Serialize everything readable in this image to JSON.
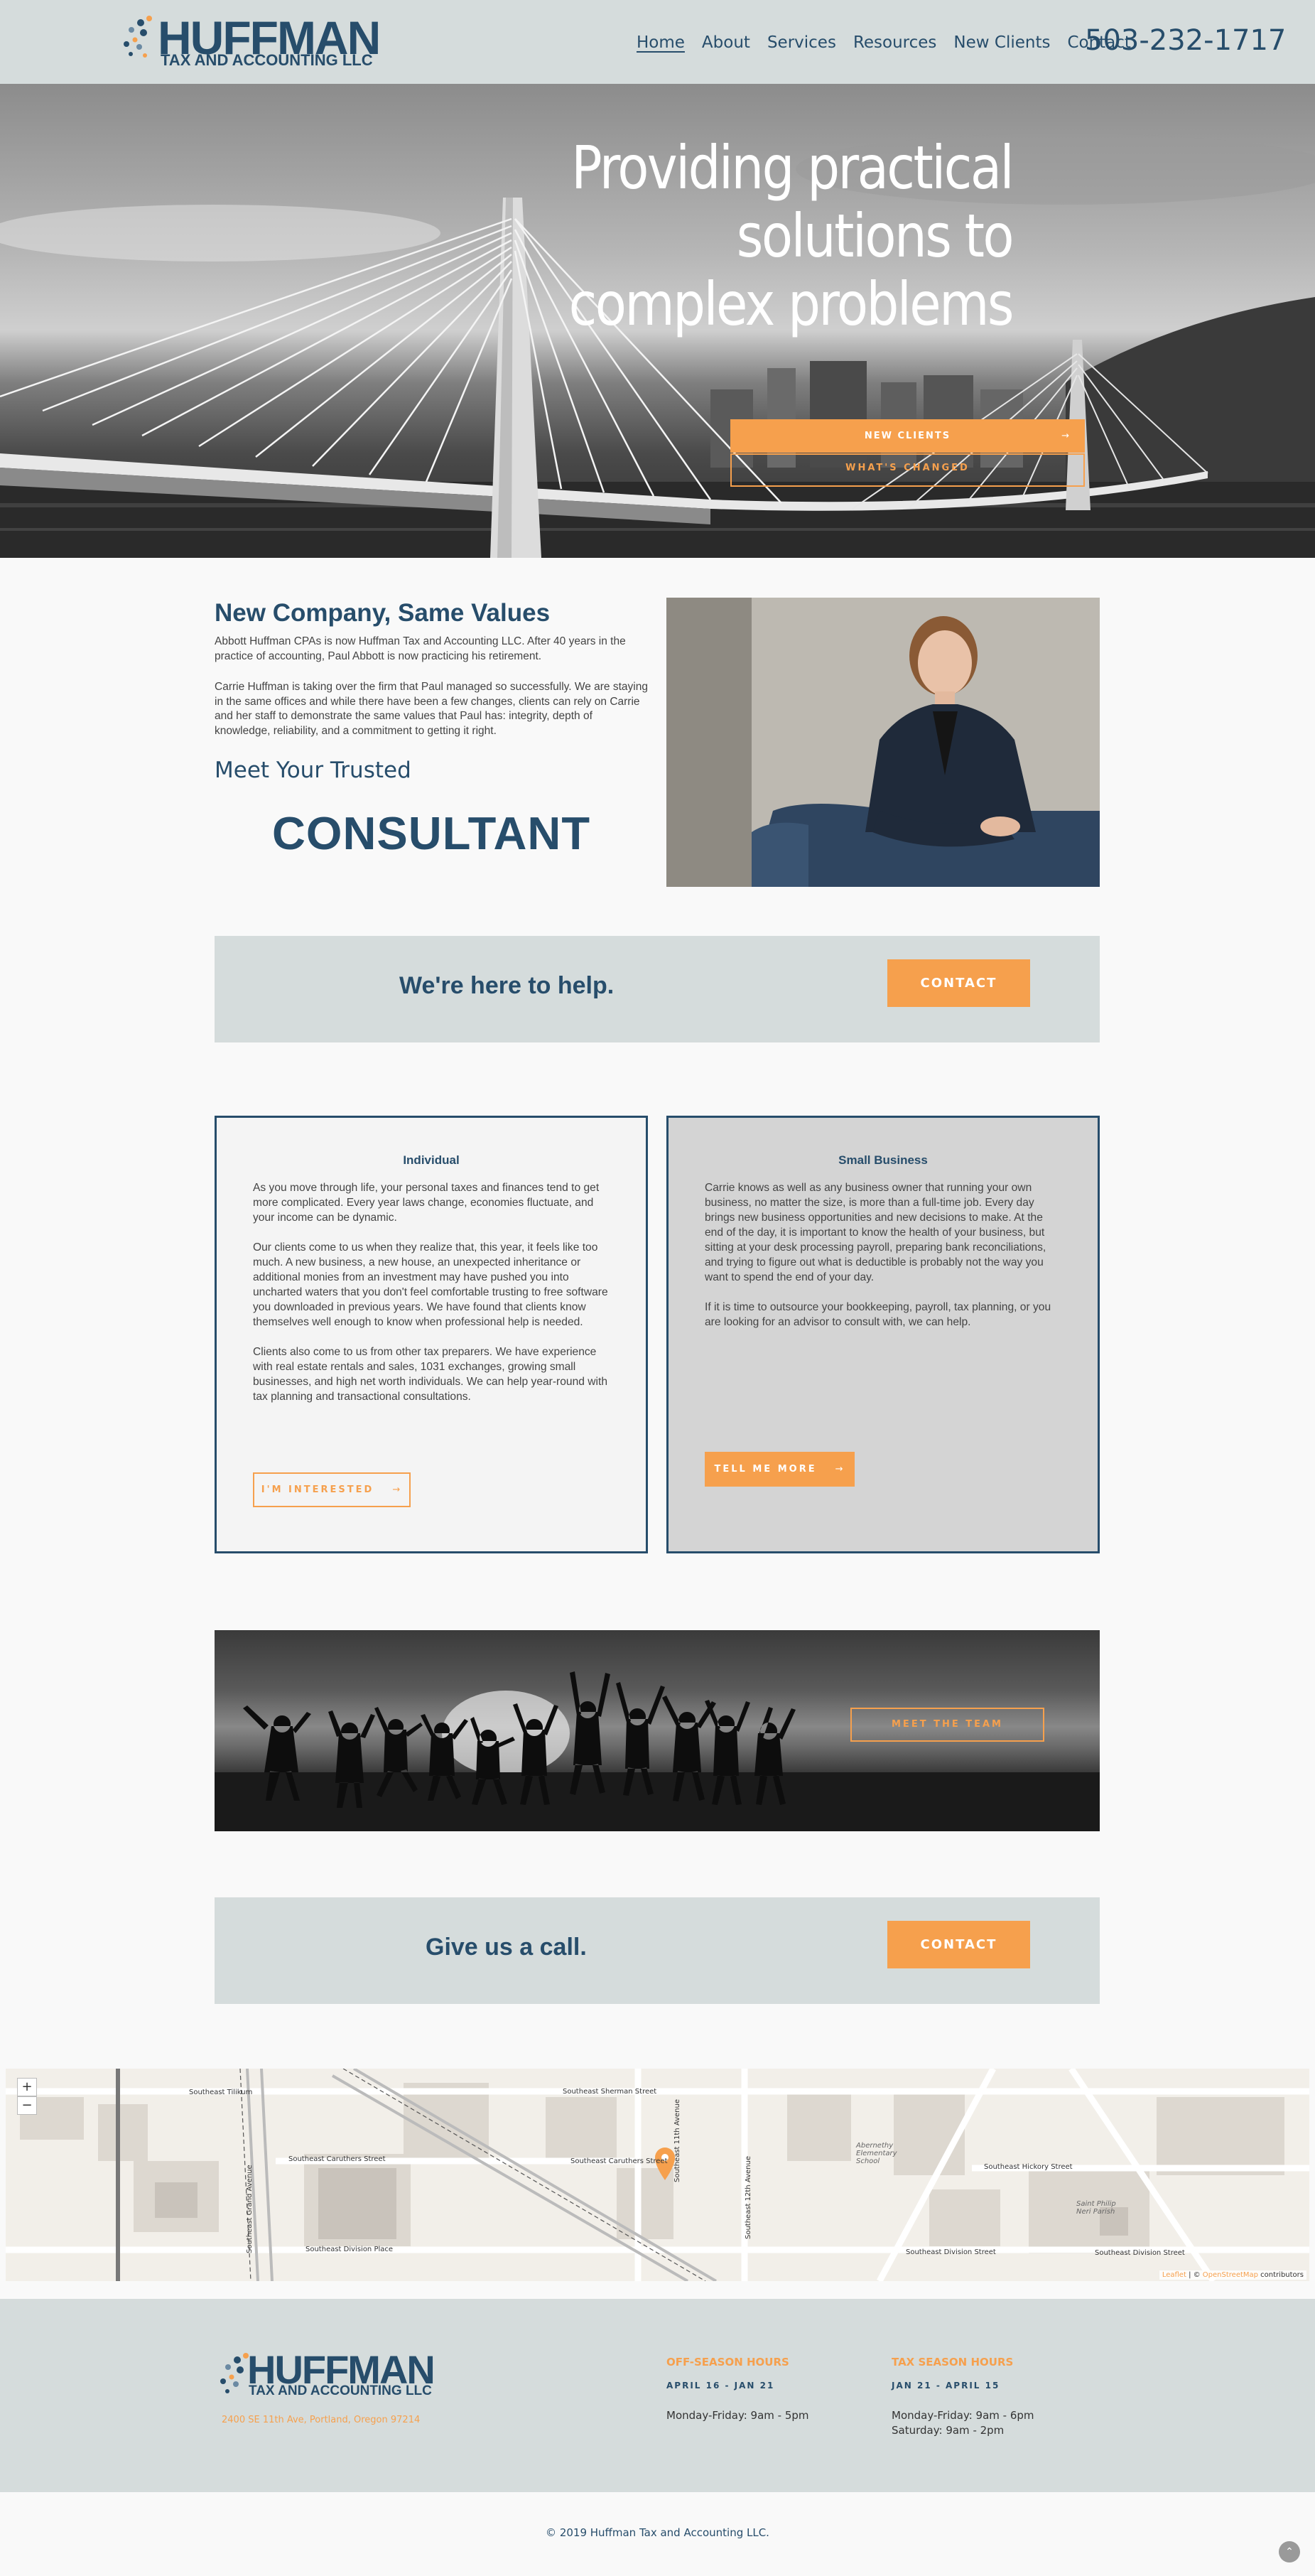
{
  "brand": {
    "name": "HUFFMAN",
    "subtitle": "TAX AND ACCOUNTING LLC"
  },
  "nav": {
    "items": [
      {
        "label": "Home",
        "active": true
      },
      {
        "label": "About"
      },
      {
        "label": "Services"
      },
      {
        "label": "Resources"
      },
      {
        "label": "New Clients"
      },
      {
        "label": "Contact"
      }
    ],
    "phone": "503-232-1717"
  },
  "hero": {
    "title_line1": "Providing practical solutions to",
    "title_line2": "complex problems",
    "primary_button": "NEW CLIENTS",
    "secondary_button": "WHAT'S CHANGED"
  },
  "intro": {
    "title": "New Company, Same Values",
    "paragraph1": "Abbott Huffman CPAs is now Huffman Tax and Accounting LLC. After 40 years in the practice of accounting, Paul Abbott is now practicing his retirement.",
    "paragraph2": "Carrie Huffman is taking over the firm that Paul managed so successfully. We are staying in the same offices and while there have been a few changes, clients can rely on Carrie and her staff to demonstrate the same values that Paul has: integrity, depth of knowledge, reliability, and a commitment to getting it right.",
    "meet_heading": "Meet Your Trusted",
    "rotating_word": "CONSULTANT"
  },
  "cta1": {
    "text": "We're here to help.",
    "button": "CONTACT"
  },
  "cards": {
    "individual": {
      "title": "Individual",
      "p1": "As you move through life, your personal taxes and finances tend to get more complicated. Every year laws change, economies fluctuate, and your income can be dynamic.",
      "p2": "Our clients come to us when they realize that, this year, it feels like too much. A new business, a new house, an unexpected inheritance or additional monies from an investment may have pushed you into uncharted waters that you don't feel comfortable trusting to free software you downloaded in previous years. We have found that clients know themselves well enough to know when professional help is needed.",
      "p3": "Clients also come to us from other tax preparers. We have experience with real estate rentals and sales, 1031 exchanges, growing small businesses, and high net worth individuals. We can help year-round with tax planning and transactional consultations.",
      "button": "I'M INTERESTED"
    },
    "small_business": {
      "title": "Small Business",
      "p1": "Carrie knows as well as any business owner that running your own business, no matter the size, is more than a full-time job. Every day brings new business opportunities and new decisions to make. At the end of the day, it is important to know the health of your business, but sitting at your desk processing payroll, preparing bank reconciliations, and trying to figure out what is deductible is probably not the way you want to spend the end of your day.",
      "p2": "If it is time to outsource your bookkeeping, payroll, tax planning, or you are looking for an advisor to consult with, we can help.",
      "button": "TELL ME MORE"
    }
  },
  "team": {
    "button": "MEET THE TEAM"
  },
  "cta2": {
    "text": "Give us a call.",
    "button": "CONTACT"
  },
  "map": {
    "zoom_in": "+",
    "zoom_out": "−",
    "streets": {
      "s1": "Southeast Sherman Street",
      "s2": "Southeast Caruthers Street",
      "s3": "Southeast Caruthers Street",
      "s4": "Southeast Division Place",
      "s5": "Southeast Division Street",
      "s6": "Southeast Division Street",
      "s7": "Southeast Hickory Street",
      "s8": "Southeast 11th Avenue",
      "s9": "Southeast 12th Avenue",
      "s10": "Southeast Grand Avenue",
      "s11": "Southeast Tilikum",
      "s12": "Abernethy Elementary School",
      "s13": "Saint Philip Neri Parish"
    },
    "attribution_leaflet": "Leaflet",
    "attribution_sep": " | © ",
    "attribution_osm": "OpenStreetMap",
    "attribution_tail": " contributors"
  },
  "footer": {
    "address": "2400 SE 11th Ave, Portland, Oregon 97214",
    "offseason": {
      "heading": "OFF-SEASON HOURS",
      "dates": "APRIL 16 - JAN 21",
      "line1": "Monday-Friday: 9am - 5pm"
    },
    "taxseason": {
      "heading": "TAX SEASON HOURS",
      "dates": "JAN 21 - APRIL 15",
      "line1": "Monday-Friday: 9am - 6pm",
      "line2": "Saturday: 9am - 2pm"
    },
    "copyright": "© 2019 Huffman Tax and Accounting LLC."
  },
  "colors": {
    "navy": "#274d6b",
    "orange": "#f6a04d",
    "band": "#d5dcdc"
  }
}
